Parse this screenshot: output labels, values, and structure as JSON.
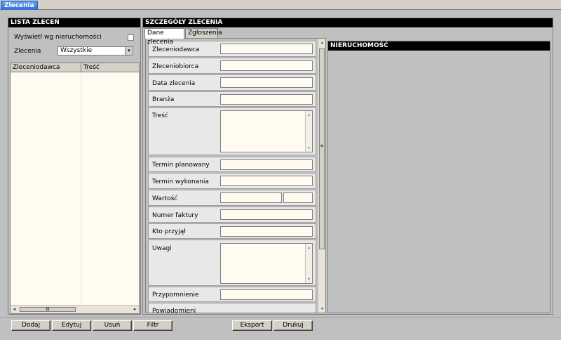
{
  "window": {
    "tab_title": "Zlecenia"
  },
  "left_panel": {
    "title": "LISTA ZLECEŃ",
    "show_by_property_label": "Wyświetl wg nieruchomości",
    "show_by_property_checked": false,
    "orders_label": "Zlecenia",
    "orders_select_value": "Wszystkie",
    "columns": [
      "Zleceniodawca",
      "Treść"
    ],
    "rows": [],
    "hscroll_thumb_glyph": "III"
  },
  "right_panel": {
    "title": "SZCZEGÓŁY ZLECENIA",
    "tabs": [
      {
        "label": "Dane zlecenia",
        "active": true
      },
      {
        "label": "Zgłoszenia",
        "active": false
      }
    ],
    "fields": {
      "client": {
        "label": "Zleceniodawca",
        "value": ""
      },
      "contractor": {
        "label": "Zleceniobiorca",
        "value": ""
      },
      "order_date": {
        "label": "Data zlecenia",
        "value": ""
      },
      "industry": {
        "label": "Branża",
        "value": ""
      },
      "content": {
        "label": "Treść",
        "value": ""
      },
      "planned_date": {
        "label": "Termin planowany",
        "value": ""
      },
      "completion_date": {
        "label": "Termin wykonania",
        "value": ""
      },
      "value": {
        "label": "Wartość",
        "value": "",
        "currency": ""
      },
      "invoice_number": {
        "label": "Numer faktury",
        "value": ""
      },
      "received_by": {
        "label": "Kto przyjął",
        "value": ""
      },
      "notes": {
        "label": "Uwagi",
        "value": ""
      },
      "reminder": {
        "label": "Przypomnienie",
        "value": ""
      },
      "notified": {
        "label": "Powiadomieni",
        "value": ""
      }
    },
    "property_section_title": "NIERUCHOMOŚĆ"
  },
  "toolbar": {
    "add": "Dodaj",
    "edit": "Edytuj",
    "delete": "Usuń",
    "filter": "Filtr",
    "export": "Eksport",
    "print": "Drukuj"
  },
  "icons": {
    "dropdown": "▾",
    "left": "◂",
    "right": "▸",
    "up": "▴",
    "down": "▾"
  }
}
